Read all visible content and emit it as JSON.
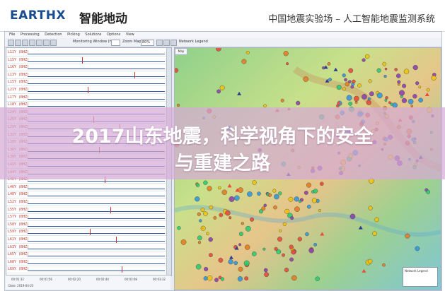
{
  "banner": {
    "logo": "EARTHX",
    "logo_sub": "智能地动",
    "system_title": "中国地震实验场 – 人工智能地震监测系统"
  },
  "app": {
    "menu": [
      "File",
      "Processing",
      "Detection",
      "Picking",
      "Solutions",
      "Options",
      "View"
    ],
    "toolbar": {
      "monitoring_label": "Monitoring Window (Hrs)",
      "zoom_label": "Zoom Map",
      "zoom_value": "80%",
      "network_legend": "Network Legend"
    },
    "channels": [
      "L11Y (BHZ)",
      "L15Y (BHZ)",
      "L16Y (BHZ)",
      "L13Y (BHZ)",
      "L15Y (BHZ)",
      "L21Y (BHZ)",
      "L17Y (BHZ)",
      "L18Y (BHZ)",
      "L24Y (BHZ)",
      "L25Y (BHZ)",
      "L29Y (BHZ)",
      "L31Y (BHZ)",
      "L33Y (BHZ)",
      "L36Y (BHZ)",
      "L39Y (BHZ)",
      "L41Y (BHZ)",
      "L44Y (BHZ)",
      "L45Y (BHZ)",
      "L46Y (BHZ)",
      "L48Y (BHZ)",
      "L52Y (BHZ)",
      "L55Y (BHZ)",
      "L57Y (BHZ)",
      "L58Y (BHZ)",
      "L59Y (BHZ)",
      "L61Y (BHZ)",
      "L63Y (BHZ)",
      "L65Y (BHZ)",
      "L68Y (BHZ)",
      "L69Y (BHZ)"
    ],
    "time_ticks": [
      "00:01:32",
      "00:01:56",
      "00:02:20",
      "00:02:44",
      "00:03:08",
      "00:03:32"
    ],
    "date_label": "Date: 2019-04-23",
    "map_tab": "Map",
    "legend_title": "Network Legend"
  },
  "overlay": {
    "line1": "2017山东地震，科学视角下的安全",
    "line2": "与重建之路"
  },
  "colors": {
    "overlay": "#d6aad6",
    "logo": "#1a4d8f",
    "channel_label": "#c0392b",
    "trace": "#3355aa"
  }
}
